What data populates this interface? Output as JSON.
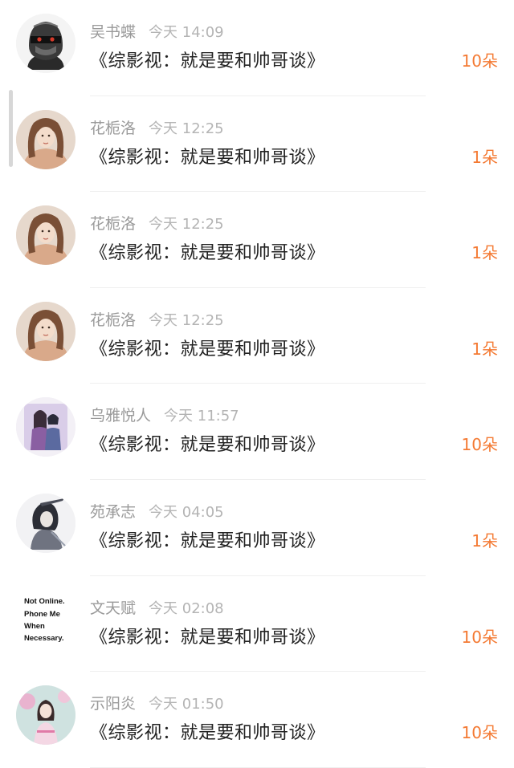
{
  "gift_records": [
    {
      "username": "吴书蝶",
      "time": "今天 14:09",
      "gift": "《综影视：就是要和帅哥谈》",
      "count": "10朵",
      "avatar_icon": "armored-knight-avatar"
    },
    {
      "username": "花栀洛",
      "time": "今天 12:25",
      "gift": "《综影视：就是要和帅哥谈》",
      "count": "1朵",
      "avatar_icon": "long-hair-girl-avatar"
    },
    {
      "username": "花栀洛",
      "time": "今天 12:25",
      "gift": "《综影视：就是要和帅哥谈》",
      "count": "1朵",
      "avatar_icon": "long-hair-girl-avatar"
    },
    {
      "username": "花栀洛",
      "time": "今天 12:25",
      "gift": "《综影视：就是要和帅哥谈》",
      "count": "1朵",
      "avatar_icon": "long-hair-girl-avatar"
    },
    {
      "username": "乌雅悦人",
      "time": "今天 11:57",
      "gift": "《综影视：就是要和帅哥谈》",
      "count": "10朵",
      "avatar_icon": "anime-couple-avatar"
    },
    {
      "username": "苑承志",
      "time": "今天 04:05",
      "gift": "《综影视：就是要和帅哥谈》",
      "count": "1朵",
      "avatar_icon": "ink-swordsman-avatar"
    },
    {
      "username": "文天赋",
      "time": "今天 02:08",
      "gift": "《综影视：就是要和帅哥谈》",
      "count": "10朵",
      "avatar_icon": "text-sign-avatar",
      "avatar_text": [
        "Not Online.",
        "Phone Me",
        "When",
        "Necessary."
      ]
    },
    {
      "username": "示阳炎",
      "time": "今天 01:50",
      "gift": "《综影视：就是要和帅哥谈》",
      "count": "10朵",
      "avatar_icon": "pink-girl-avatar"
    }
  ],
  "colors": {
    "count": "#f47a33",
    "username": "#9a9a9a",
    "time": "#b4b4b4",
    "gift_text": "#222222"
  }
}
